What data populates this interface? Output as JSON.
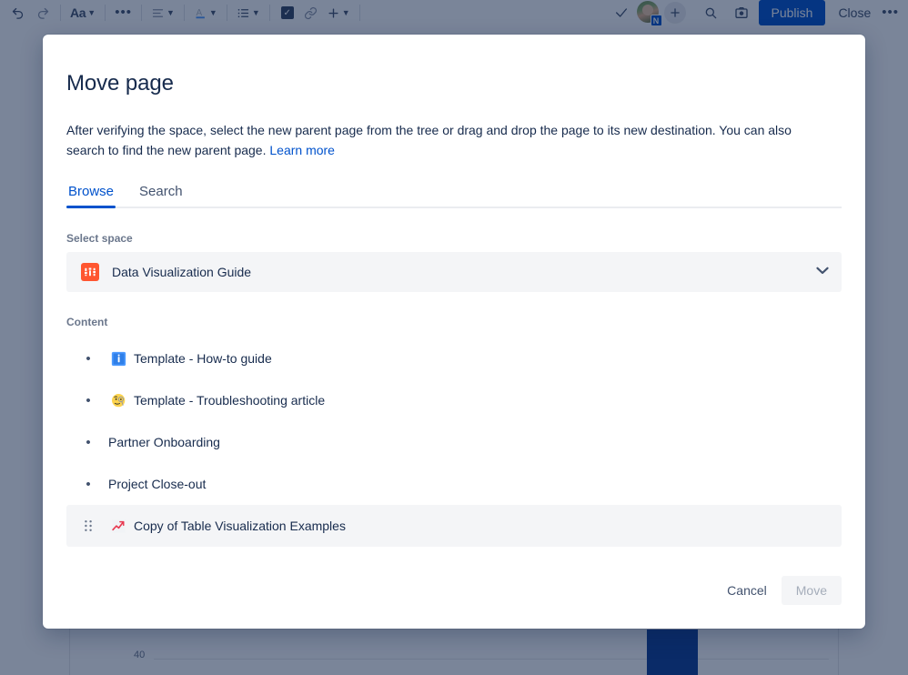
{
  "background": {
    "toolbar": {
      "undo_label": "undo-arrow",
      "redo_label": "redo-arrow",
      "text_style_label": "Aa",
      "more_formatting_label": "•••",
      "align_label": "align",
      "text_color_label": "A",
      "list_label": "list",
      "task_label": "✓",
      "link_label": "link",
      "insert_label": "+",
      "done_check_label": "✓",
      "avatar_badge": "N",
      "add_person_label": "+",
      "search_label": "search-icon",
      "preview_label": "preview-icon",
      "publish_label": "Publish",
      "close_label": "Close",
      "overflow_label": "•••"
    },
    "chart": {
      "y_tick": "40"
    }
  },
  "modal": {
    "title": "Move page",
    "description_before_link": "After verifying the space, select the new parent page from the tree or drag and drop the page to its new destination. You can also search to find the new parent page. ",
    "learn_more": "Learn more",
    "tabs": [
      {
        "label": "Browse",
        "active": true
      },
      {
        "label": "Search",
        "active": false
      }
    ],
    "select_space_label": "Select space",
    "space": {
      "name": "Data Visualization Guide",
      "icon": "sliders-icon",
      "icon_color": "#FF5630",
      "chevron": "chevron-down-icon"
    },
    "content_label": "Content",
    "tree_items": [
      {
        "label": "Template - How-to guide",
        "emoji": "information-emoji",
        "selected": false
      },
      {
        "label": "Template - Troubleshooting article",
        "emoji": "face-with-monocle-emoji",
        "selected": false
      },
      {
        "label": "Partner Onboarding",
        "emoji": "",
        "selected": false
      },
      {
        "label": "Project Close-out",
        "emoji": "",
        "selected": false
      },
      {
        "label": "Copy of Table Visualization Examples",
        "emoji": "chart-increasing-emoji",
        "selected": true
      }
    ],
    "footer": {
      "cancel_label": "Cancel",
      "move_label": "Move"
    }
  },
  "colors": {
    "accent": "#0052CC",
    "text": "#172B4D",
    "subtle_text": "#6B778C",
    "overlay": "#091E42",
    "selected_row": "#F4F5F7"
  }
}
